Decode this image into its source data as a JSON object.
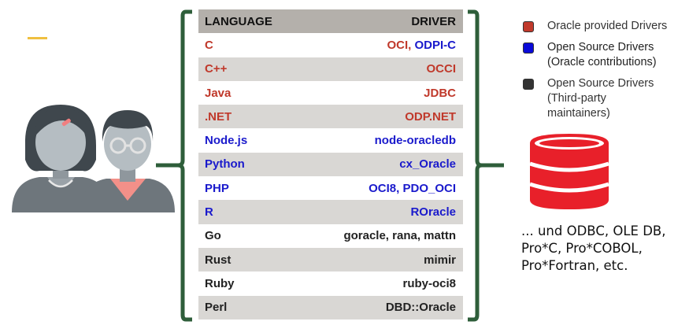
{
  "table": {
    "header": {
      "language": "LANGUAGE",
      "driver": "DRIVER"
    },
    "rows": [
      {
        "language": "C",
        "driver_parts": [
          {
            "text": "OCI, ",
            "color": "red"
          },
          {
            "text": "ODPI-C",
            "color": "blue"
          }
        ],
        "lang_color": "red"
      },
      {
        "language": "C++",
        "driver_parts": [
          {
            "text": "OCCI",
            "color": "red"
          }
        ],
        "lang_color": "red"
      },
      {
        "language": "Java",
        "driver_parts": [
          {
            "text": "JDBC",
            "color": "red"
          }
        ],
        "lang_color": "red"
      },
      {
        "language": ".NET",
        "driver_parts": [
          {
            "text": "ODP.NET",
            "color": "red"
          }
        ],
        "lang_color": "red"
      },
      {
        "language": "Node.js",
        "driver_parts": [
          {
            "text": "node-oracledb",
            "color": "blue"
          }
        ],
        "lang_color": "blue"
      },
      {
        "language": "Python",
        "driver_parts": [
          {
            "text": "cx_Oracle",
            "color": "blue"
          }
        ],
        "lang_color": "blue"
      },
      {
        "language": "PHP",
        "driver_parts": [
          {
            "text": "OCI8, PDO_OCI",
            "color": "blue"
          }
        ],
        "lang_color": "blue"
      },
      {
        "language": "R",
        "driver_parts": [
          {
            "text": "ROracle",
            "color": "blue"
          }
        ],
        "lang_color": "blue"
      },
      {
        "language": "Go",
        "driver_parts": [
          {
            "text": "goracle, rana, mattn",
            "color": "black"
          }
        ],
        "lang_color": "black"
      },
      {
        "language": "Rust",
        "driver_parts": [
          {
            "text": "mimir",
            "color": "black"
          }
        ],
        "lang_color": "black"
      },
      {
        "language": "Ruby",
        "driver_parts": [
          {
            "text": "ruby-oci8",
            "color": "black"
          }
        ],
        "lang_color": "black"
      },
      {
        "language": "Perl",
        "driver_parts": [
          {
            "text": "DBD::Oracle",
            "color": "black"
          }
        ],
        "lang_color": "black"
      }
    ]
  },
  "legend": [
    {
      "label": "Oracle provided Drivers",
      "color": "#c0392b"
    },
    {
      "label": "Open Source Drivers (Oracle contributions)",
      "color": "#0a0ad8"
    },
    {
      "label": "Open Source Drivers (Third-party maintainers)",
      "color": "#333333"
    }
  ],
  "note": "... und ODBC, OLE DB,\nPro*C, Pro*COBOL,\nPro*Fortran, etc.",
  "colors": {
    "red": "#c0392b",
    "blue": "#1a1acc",
    "black": "#222222",
    "bracket": "#2e5e3a",
    "db_red": "#e8202a"
  },
  "icons": [
    "users-icon",
    "database-icon"
  ]
}
